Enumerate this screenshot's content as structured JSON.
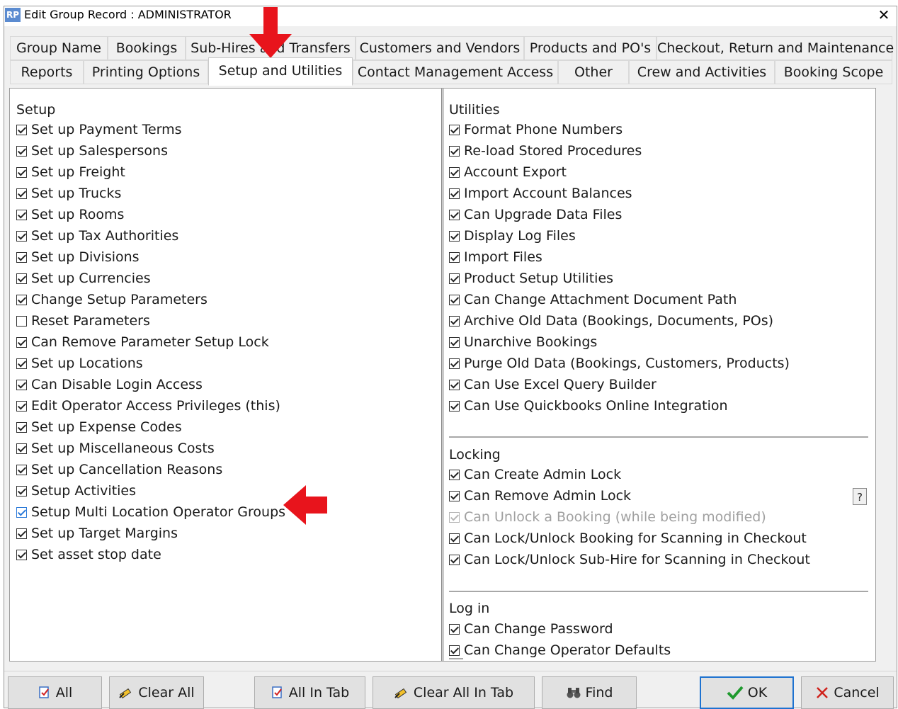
{
  "window": {
    "app_icon_text": "RP",
    "title": "Edit Group Record : ADMINISTRATOR",
    "close_glyph": "✕"
  },
  "tabs_row1": [
    {
      "label": "Group Name"
    },
    {
      "label": "Bookings"
    },
    {
      "label": "Sub-Hires and Transfers"
    },
    {
      "label": "Customers and Vendors"
    },
    {
      "label": "Products and PO's"
    },
    {
      "label": "Checkout, Return and Maintenance"
    }
  ],
  "tabs_row2": [
    {
      "label": "Reports"
    },
    {
      "label": "Printing Options"
    },
    {
      "label": "Setup and Utilities",
      "active": true
    },
    {
      "label": "Contact Management Access"
    },
    {
      "label": "Other"
    },
    {
      "label": "Crew and Activities"
    },
    {
      "label": "Booking Scope"
    }
  ],
  "setup": {
    "title": "Setup",
    "items": [
      {
        "label": "Set up Payment Terms",
        "checked": true
      },
      {
        "label": "Set up Salespersons",
        "checked": true
      },
      {
        "label": "Set up Freight",
        "checked": true
      },
      {
        "label": "Set up Trucks",
        "checked": true
      },
      {
        "label": "Set up Rooms",
        "checked": true
      },
      {
        "label": "Set up Tax Authorities",
        "checked": true
      },
      {
        "label": "Set up Divisions",
        "checked": true
      },
      {
        "label": "Set up Currencies",
        "checked": true
      },
      {
        "label": "Change Setup Parameters",
        "checked": true
      },
      {
        "label": "Reset Parameters",
        "checked": false
      },
      {
        "label": "Can Remove Parameter Setup Lock",
        "checked": true
      },
      {
        "label": "Set up Locations",
        "checked": true
      },
      {
        "label": "Can Disable Login Access",
        "checked": true
      },
      {
        "label": "Edit Operator Access Privileges (this)",
        "checked": true
      },
      {
        "label": "Set up Expense Codes",
        "checked": true
      },
      {
        "label": "Set up Miscellaneous Costs",
        "checked": true
      },
      {
        "label": "Set up Cancellation Reasons",
        "checked": true
      },
      {
        "label": "Setup Activities",
        "checked": true
      },
      {
        "label": "Setup Multi Location Operator Groups",
        "checked": true,
        "focused": true
      },
      {
        "label": "Set up Target Margins",
        "checked": true
      },
      {
        "label": "Set asset stop date",
        "checked": true
      }
    ]
  },
  "utilities": {
    "title": "Utilities",
    "items": [
      {
        "label": "Format Phone Numbers",
        "checked": true
      },
      {
        "label": "Re-load Stored Procedures",
        "checked": true
      },
      {
        "label": "Account Export",
        "checked": true
      },
      {
        "label": "Import Account Balances",
        "checked": true
      },
      {
        "label": "Can Upgrade Data Files",
        "checked": true
      },
      {
        "label": "Display Log Files",
        "checked": true
      },
      {
        "label": "Import Files",
        "checked": true
      },
      {
        "label": "Product Setup Utilities",
        "checked": true
      },
      {
        "label": "Can Change Attachment Document Path",
        "checked": true
      },
      {
        "label": "Archive Old Data (Bookings, Documents, POs)",
        "checked": true
      },
      {
        "label": "Unarchive Bookings",
        "checked": true
      },
      {
        "label": "Purge Old Data (Bookings, Customers, Products)",
        "checked": true
      },
      {
        "label": "Can Use Excel Query Builder",
        "checked": true
      },
      {
        "label": "Can Use Quickbooks Online Integration",
        "checked": true
      }
    ]
  },
  "locking": {
    "title": "Locking",
    "items": [
      {
        "label": "Can Create Admin Lock",
        "checked": true
      },
      {
        "label": "Can Remove Admin Lock",
        "checked": true
      },
      {
        "label": "Can Unlock a Booking (while being modified)",
        "checked": true,
        "disabled": true
      },
      {
        "label": "Can Lock/Unlock Booking for Scanning in Checkout",
        "checked": true
      },
      {
        "label": "Can Lock/Unlock Sub-Hire for Scanning in Checkout",
        "checked": true
      }
    ]
  },
  "login": {
    "title": "Log in",
    "items": [
      {
        "label": "Can Change Password",
        "checked": true
      },
      {
        "label": "Can Change Operator Defaults",
        "checked": true
      }
    ]
  },
  "help_button": {
    "label": "?"
  },
  "buttons": [
    {
      "label": "All",
      "icon": "check-document-icon"
    },
    {
      "label": "Clear All",
      "icon": "eraser-icon"
    },
    {
      "label": "All In Tab",
      "icon": "check-document-icon"
    },
    {
      "label": "Clear All In Tab",
      "icon": "eraser-icon"
    },
    {
      "label": "Find",
      "icon": "binoculars-icon"
    },
    {
      "label": "OK",
      "icon": "green-check-icon"
    },
    {
      "label": "Cancel",
      "icon": "red-x-icon"
    }
  ],
  "colors": {
    "annotation_arrow": "#e8141c",
    "focus_blue": "#1e72d0",
    "ok_check": "#1f9a2e",
    "cancel_x": "#d0221c"
  }
}
